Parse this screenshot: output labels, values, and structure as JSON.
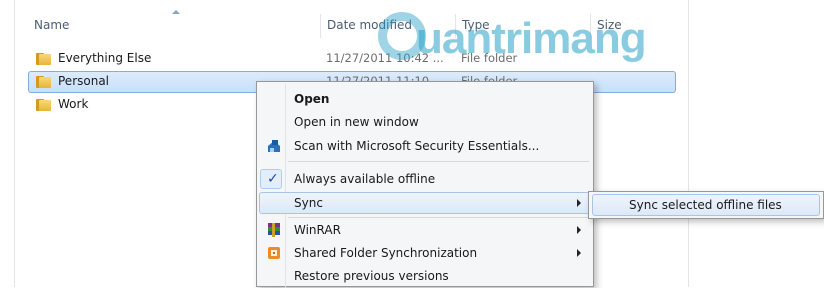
{
  "columns": {
    "name": "Name",
    "date_modified": "Date modified",
    "type": "Type",
    "size": "Size"
  },
  "files": [
    {
      "name": "Everything Else",
      "date": "11/27/2011 10:42 ...",
      "type": "File folder",
      "selected": false
    },
    {
      "name": "Personal",
      "date": "11/27/2011 11:10 ...",
      "type": "File folder",
      "selected": true
    },
    {
      "name": "Work",
      "date": "",
      "type": "",
      "selected": false
    }
  ],
  "watermark": "uantrimang",
  "context_menu": {
    "open": "Open",
    "open_new_window": "Open in new window",
    "scan": "Scan with Microsoft Security Essentials...",
    "always_offline": "Always available offline",
    "sync": "Sync",
    "winrar": "WinRAR",
    "shared_folder_sync": "Shared Folder Synchronization",
    "restore_versions": "Restore previous versions"
  },
  "sync_submenu": {
    "sync_selected": "Sync selected offline files"
  },
  "icons": {
    "folder": "folder-icon",
    "scan": "security-essentials-icon",
    "check": "checkmark-icon",
    "winrar": "winrar-icon",
    "shared": "shared-folder-sync-icon",
    "submenu_arrow": "chevron-right-icon"
  }
}
